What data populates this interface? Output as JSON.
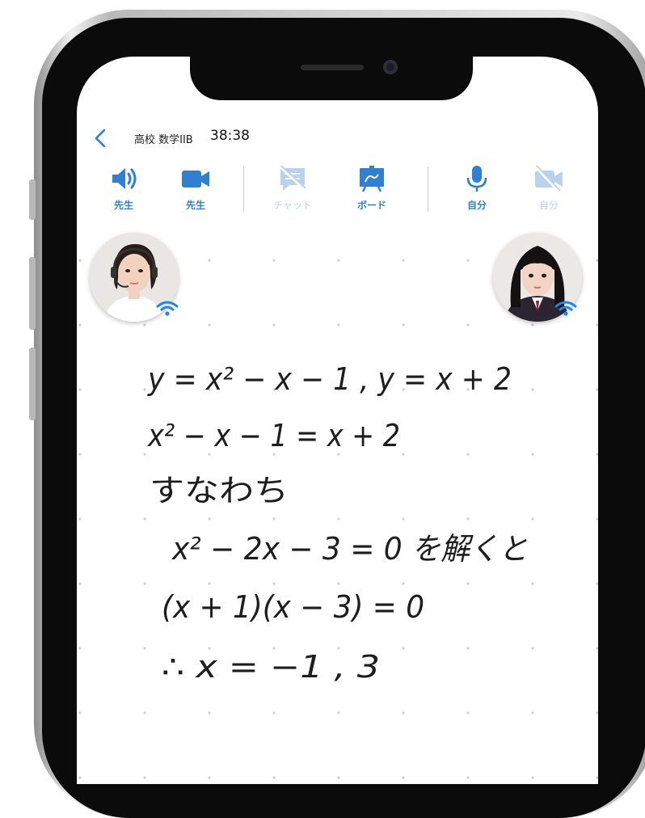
{
  "header": {
    "back_icon": "chevron-left-icon",
    "title": "高校 数学IIB",
    "timer": "38:38"
  },
  "toolbar": {
    "items": [
      {
        "icon": "speaker-icon",
        "label": "先生",
        "active": true
      },
      {
        "icon": "video-camera-icon",
        "label": "先生",
        "active": true
      },
      {
        "icon": "chat-off-icon",
        "label": "チャット",
        "active": false
      },
      {
        "icon": "whiteboard-icon",
        "label": "ボード",
        "active": true
      },
      {
        "icon": "microphone-icon",
        "label": "自分",
        "active": true
      },
      {
        "icon": "video-camera-off-icon",
        "label": "自分",
        "active": false
      }
    ]
  },
  "colors": {
    "accent": "#2f80d3",
    "disabled": "#b9d3ee",
    "wifi": "#1e88e5"
  },
  "board": {
    "lines": [
      "y = x² − x − 1 , y = x + 2",
      "x² − x − 1 = x + 2",
      "すなわち",
      "x² − 2x − 3 = 0 を解くと",
      "(x + 1)(x − 3) = 0",
      "∴ x = −1 , 3"
    ]
  }
}
